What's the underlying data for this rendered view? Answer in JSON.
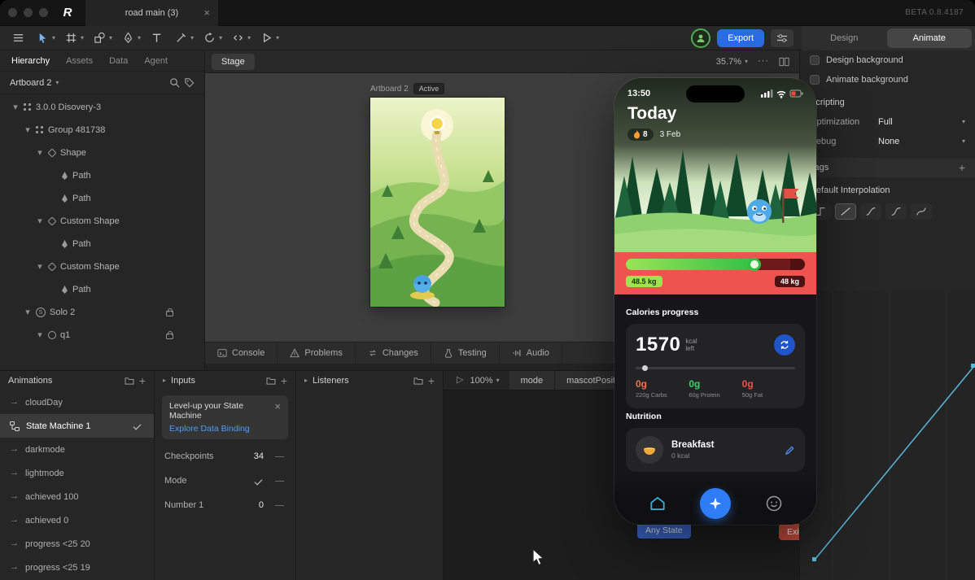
{
  "titlebar": {
    "doc_tab": "road main (3)",
    "beta": "BETA 0.8.4187"
  },
  "toolbar": {
    "export": "Export",
    "design": "Design",
    "animate": "Animate"
  },
  "hierarchy": {
    "tab_hierarchy": "Hierarchy",
    "tab_assets": "Assets",
    "tab_data": "Data",
    "tab_agent": "Agent",
    "artboard": "Artboard 2",
    "tree": [
      {
        "label": "3.0.0 Disovery-3"
      },
      {
        "label": "Group 481738"
      },
      {
        "label": "Shape"
      },
      {
        "label": "Path"
      },
      {
        "label": "Path"
      },
      {
        "label": "Custom Shape"
      },
      {
        "label": "Path"
      },
      {
        "label": "Custom Shape"
      },
      {
        "label": "Path"
      },
      {
        "label": "Solo 2",
        "locked": true
      },
      {
        "label": "q1",
        "locked": true
      }
    ]
  },
  "stage": {
    "tab": "Stage",
    "zoom": "35.7%",
    "artboard_label": "Artboard 2",
    "artboard_state": "Active",
    "console_tabs": [
      {
        "label": "Console"
      },
      {
        "label": "Problems"
      },
      {
        "label": "Changes"
      },
      {
        "label": "Testing"
      },
      {
        "label": "Audio"
      }
    ]
  },
  "inspector": {
    "design_bg": "Design background",
    "animate_bg": "Animate background",
    "scripting": "Scripting",
    "optimization_label": "Optimization",
    "optimization_value": "Full",
    "debug_label": "Debug",
    "debug_value": "None",
    "tags_label": "Tags",
    "interpolation_label": "Default Interpolation"
  },
  "phone": {
    "time": "13:50",
    "title": "Today",
    "streak_count": "8",
    "date": "3 Feb",
    "weight_current": "48.5 kg",
    "weight_goal": "48 kg",
    "calories_label": "Calories progress",
    "calories_value": "1570",
    "calories_unit_line1": "kcal",
    "calories_unit_line2": "left",
    "macros": [
      {
        "value": "0g",
        "label": "220g Carbs"
      },
      {
        "value": "0g",
        "label": "60g Protein"
      },
      {
        "value": "0g",
        "label": "50g Fat"
      }
    ],
    "nutrition_label": "Nutrition",
    "meal_title": "Breakfast",
    "meal_kcal": "0 kcal"
  },
  "animations": {
    "title": "Animations",
    "items": [
      {
        "label": "cloudDay",
        "type": "animation"
      },
      {
        "label": "State Machine 1",
        "type": "state-machine",
        "selected": true
      },
      {
        "label": "darkmode",
        "type": "animation"
      },
      {
        "label": "lightmode",
        "type": "animation"
      },
      {
        "label": "achieved 100",
        "type": "animation"
      },
      {
        "label": "achieved 0",
        "type": "animation"
      },
      {
        "label": "progress <25 20",
        "type": "animation"
      },
      {
        "label": "progress <25 19",
        "type": "animation"
      }
    ]
  },
  "inputs": {
    "title": "Inputs",
    "promo_title": "Level-up your State Machine",
    "promo_link": "Explore Data Binding",
    "row1_label": "Checkpoints",
    "row1_value": "34",
    "row2_label": "Mode",
    "row2_checked": true,
    "row3_label": "Number 1",
    "row3_value": "0"
  },
  "listeners": {
    "title": "Listeners"
  },
  "timeline": {
    "zoom": "100%",
    "tab1": "mode",
    "tab2": "mascotPosition",
    "state1": "Any State",
    "state2": "Exit"
  },
  "colors": {
    "accent_blue": "#2e7cf6",
    "export_blue": "#2b6ce5",
    "link_blue": "#4f9cf7",
    "red_section": "#ef5350",
    "progress_green": "#2ebf45",
    "carbs": "#f4734f",
    "protein": "#3dd068",
    "fat": "#f4504a",
    "any_state": "#3d6ad2",
    "exit_state": "#c84b3e"
  },
  "icons": {
    "search-icon": "magnifier",
    "tag-icon": "tag",
    "folder-icon": "folder",
    "plus-icon": "+",
    "close-icon": "x",
    "caret-down-icon": "triangle-down",
    "caret-right-icon": "triangle-right",
    "play-icon": "triangle-play",
    "one-shot-animation-icon": "arrow-right",
    "check-icon": "check",
    "lock-icon": "padlock",
    "flame-icon": "flame",
    "edit-pencil-icon": "pencil",
    "home-nav-icon": "house",
    "add-nav-button": "sparkle",
    "profile-nav-icon": "smiley",
    "sync-icon": "refresh-arrows",
    "more-icon": "ellipsis"
  }
}
